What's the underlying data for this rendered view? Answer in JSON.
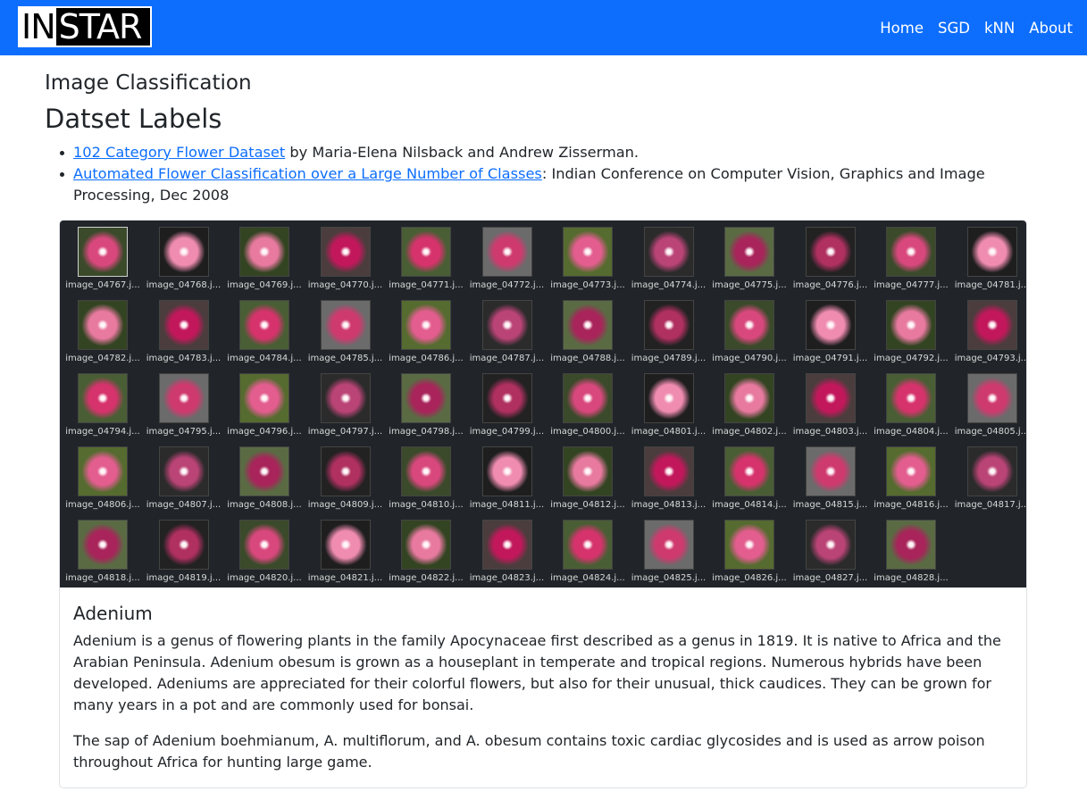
{
  "navbar": {
    "logo_part1": "IN",
    "logo_part2": "STAR",
    "links": [
      "Home",
      "SGD",
      "kNN",
      "About"
    ],
    "background": "#0d6efd"
  },
  "page": {
    "subtitle": "Image Classification",
    "title": "Datset Labels"
  },
  "references": [
    {
      "link": "102 Category Flower Dataset",
      "text": " by Maria-Elena Nilsback and Andrew Zisserman."
    },
    {
      "link": "Automated Flower Classification over a Large Number of Classes",
      "text": ": Indian Conference on Computer Vision, Graphics and Image Processing, Dec 2008"
    }
  ],
  "gallery": {
    "background": "#212529",
    "images": [
      "image_04767.j...",
      "image_04768.j...",
      "image_04769.j...",
      "image_04770.j...",
      "image_04771.j...",
      "image_04772.j...",
      "image_04773.j...",
      "image_04774.j...",
      "image_04775.j...",
      "image_04776.j...",
      "image_04777.j...",
      "image_04781.j...",
      "image_04782.j...",
      "image_04783.j...",
      "image_04784.j...",
      "image_04785.j...",
      "image_04786.j...",
      "image_04787.j...",
      "image_04788.j...",
      "image_04789.j...",
      "image_04790.j...",
      "image_04791.j...",
      "image_04792.j...",
      "image_04793.j...",
      "image_04794.j...",
      "image_04795.j...",
      "image_04796.j...",
      "image_04797.j...",
      "image_04798.j...",
      "image_04799.j...",
      "image_04800.j...",
      "image_04801.j...",
      "image_04802.j...",
      "image_04803.j...",
      "image_04804.j...",
      "image_04805.j...",
      "image_04806.j...",
      "image_04807.j...",
      "image_04808.j...",
      "image_04809.j...",
      "image_04810.j...",
      "image_04811.j...",
      "image_04812.j...",
      "image_04813.j...",
      "image_04814.j...",
      "image_04815.j...",
      "image_04816.j...",
      "image_04817.j...",
      "image_04818.j...",
      "image_04819.j...",
      "image_04820.j...",
      "image_04821.j...",
      "image_04822.j...",
      "image_04823.j...",
      "image_04824.j...",
      "image_04825.j...",
      "image_04826.j...",
      "image_04827.j...",
      "image_04828.j..."
    ]
  },
  "description": {
    "heading": "Adenium",
    "paragraphs": [
      "Adenium is a genus of flowering plants in the family Apocynaceae first described as a genus in 1819. It is native to Africa and the Arabian Peninsula. Adenium obesum is grown as a houseplant in temperate and tropical regions. Numerous hybrids have been developed. Adeniums are appreciated for their colorful flowers, but also for their unusual, thick caudices. They can be grown for many years in a pot and are commonly used for bonsai.",
      "The sap of Adenium boehmianum, A. multiflorum, and A. obesum contains toxic cardiac glycosides and is used as arrow poison throughout Africa for hunting large game."
    ]
  }
}
